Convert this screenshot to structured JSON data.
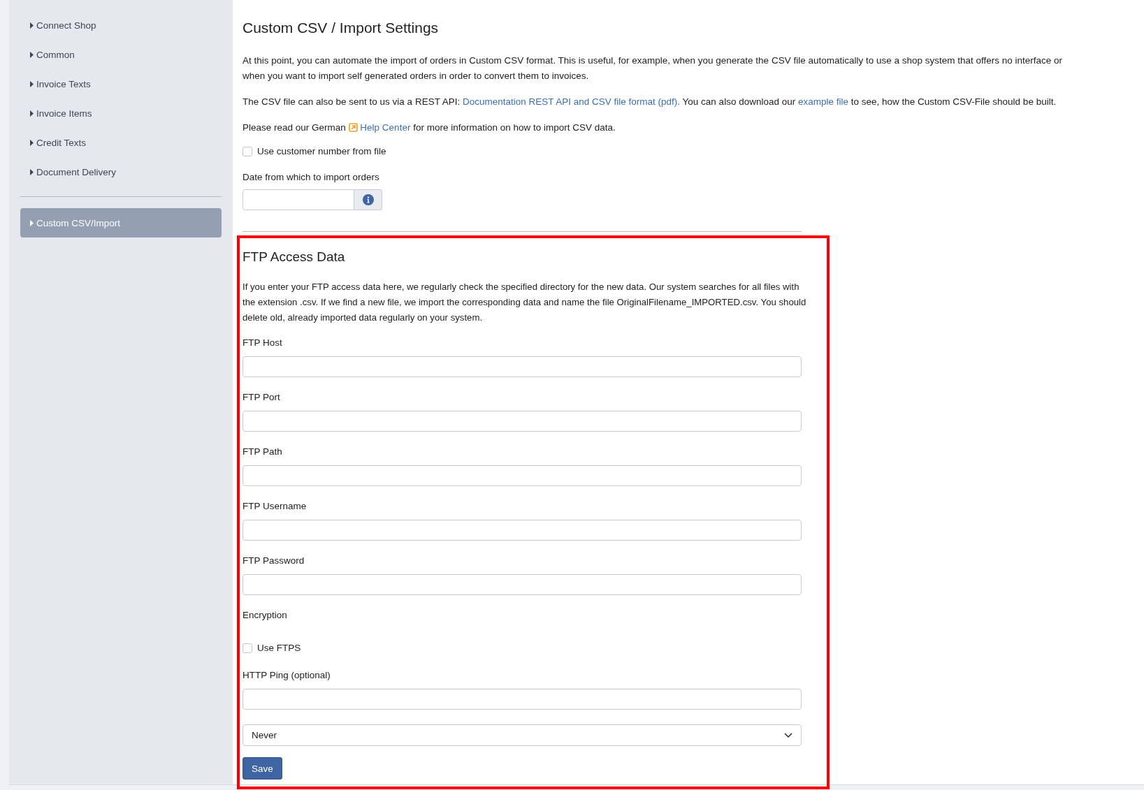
{
  "sidebar": {
    "groups": [
      {
        "items": [
          {
            "label": "Connect Shop",
            "selected": false
          },
          {
            "label": "Common",
            "selected": false
          },
          {
            "label": "Invoice Texts",
            "selected": false
          },
          {
            "label": "Invoice Items",
            "selected": false
          },
          {
            "label": "Credit Texts",
            "selected": false
          },
          {
            "label": "Document Delivery",
            "selected": false
          }
        ]
      },
      {
        "items": [
          {
            "label": "Custom CSV/Import",
            "selected": true
          }
        ]
      }
    ]
  },
  "main": {
    "title": "Custom CSV / Import Settings",
    "paragraphs": [
      [
        {
          "kind": "text",
          "text": "At this point, you can automate the import of orders in Custom CSV format. This is useful, for example, when you generate the CSV file automatically to use a shop system that offers no interface or when you want to import self generated orders in order to convert them to invoices."
        }
      ],
      [
        {
          "kind": "text",
          "text": "The CSV file can also be sent to us via a REST API: "
        },
        {
          "kind": "link",
          "text": "Documentation REST API and CSV file format (pdf)."
        },
        {
          "kind": "text",
          "text": " You can also download our "
        },
        {
          "kind": "link",
          "text": "example file"
        },
        {
          "kind": "text",
          "text": " to see, how the Custom CSV-File should be built."
        }
      ],
      [
        {
          "kind": "text",
          "text": "Please read our German "
        },
        {
          "kind": "external_link",
          "text": "Help Center"
        },
        {
          "kind": "text",
          "text": " for more information on how to import CSV data."
        }
      ]
    ],
    "customer_number_checkbox": {
      "label": "Use customer number from file",
      "checked": false
    },
    "date_field": {
      "label": "Date from which to import orders"
    }
  },
  "ftp": {
    "highlighted": true,
    "title": "FTP Access Data",
    "description": "If you enter your FTP access data here, we regularly check the specified directory for the new data. Our system searches for all files with the extension .csv. If we find a new file, we import the corresponding data and name the file OriginalFilename_IMPORTED.csv. You should delete old, already imported data regularly on your system.",
    "fields": [
      {
        "label": "FTP Host"
      },
      {
        "label": "FTP Port"
      },
      {
        "label": "FTP Path"
      },
      {
        "label": "FTP Username"
      },
      {
        "label": "FTP Password"
      }
    ],
    "encryption": {
      "label": "Encryption",
      "checkbox": {
        "label": "Use FTPS",
        "checked": false
      }
    },
    "ping": {
      "label": "HTTP Ping (optional)",
      "select": {
        "value": "Never"
      }
    },
    "save_button": "Save"
  }
}
